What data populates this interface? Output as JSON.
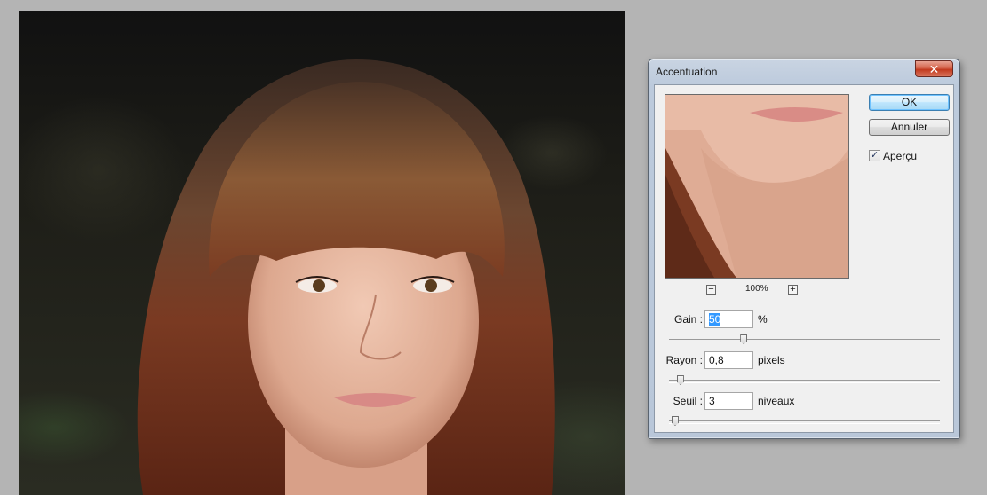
{
  "dialog": {
    "title": "Accentuation",
    "close_glyph": "✕",
    "ok_label": "OK",
    "cancel_label": "Annuler",
    "preview_checked": true,
    "preview_label": "Aperçu",
    "zoom": {
      "minus_glyph": "−",
      "plus_glyph": "+",
      "level": "100%"
    },
    "params": {
      "gain": {
        "label": "Gain :",
        "value": "50",
        "unit": "%",
        "slider_fraction": 0.27
      },
      "rayon": {
        "label": "Rayon :",
        "value": "0,8",
        "unit": "pixels",
        "slider_fraction": 0.03
      },
      "seuil": {
        "label": "Seuil :",
        "value": "3",
        "unit": "niveaux",
        "slider_fraction": 0.01
      }
    }
  },
  "icons": {
    "close": "close-icon",
    "check": "checkmark-icon",
    "zoom_out": "zoom-out-icon",
    "zoom_in": "zoom-in-icon"
  },
  "colors": {
    "ok_button_accent": "#3c7fb1",
    "close_button": "#c2391e",
    "selection": "#3399ff"
  }
}
